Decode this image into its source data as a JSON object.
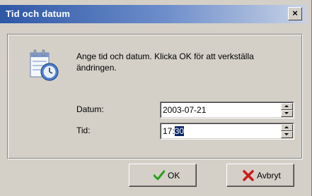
{
  "window": {
    "title": "Tid och datum",
    "close_label": "×"
  },
  "info": {
    "text": "Ange tid och datum. Klicka OK för att verkställa ändringen."
  },
  "fields": {
    "date": {
      "label": "Datum:",
      "value": "2003-07-21"
    },
    "time": {
      "label": "Tid:",
      "value_prefix": "17:",
      "value_selected": "30"
    }
  },
  "buttons": {
    "ok_label": "OK",
    "cancel_label": "Avbryt"
  },
  "icons": {
    "app": "clock-calendar-icon",
    "ok": "checkmark-icon",
    "cancel": "x-icon"
  },
  "colors": {
    "title_bar_start": "#2e57a6",
    "title_bar_end": "#c7d2e6",
    "selection": "#0a246a",
    "ok_check": "#2e9e1a",
    "cancel_x": "#cc1a1a"
  }
}
